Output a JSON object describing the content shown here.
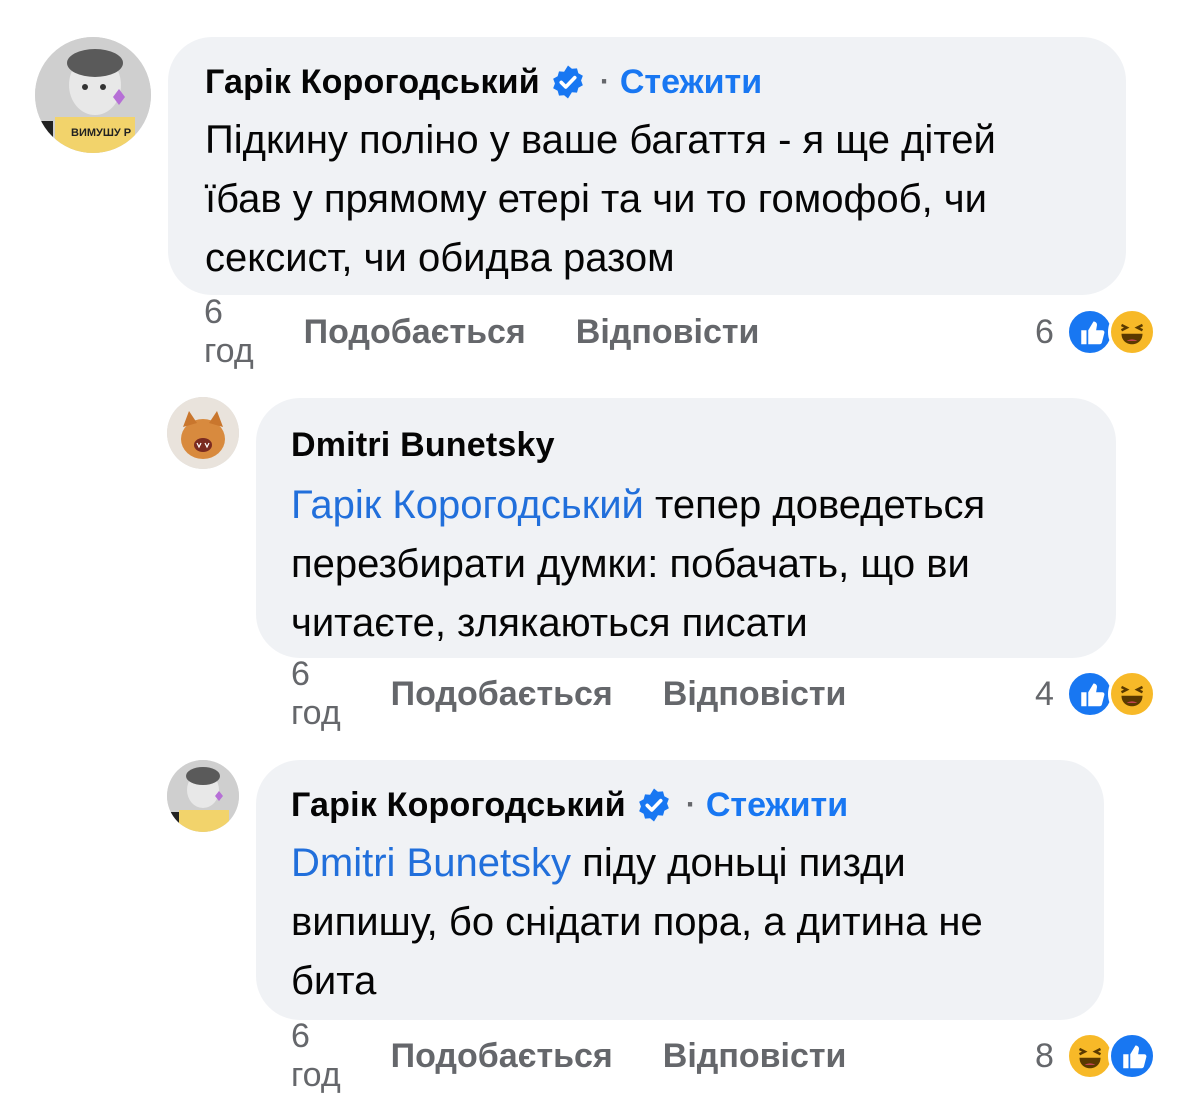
{
  "comments": [
    {
      "author": "Гарік Корогодський",
      "verified": true,
      "follow_label": "Стежити",
      "dot": "·",
      "mention": "",
      "text_lines": [
        "Підкину поліно у ваше багаття - я ще дітей",
        "їбав у прямому етері та чи то гомофоб, чи",
        "сексист, чи обидва разом"
      ],
      "time": "6 год",
      "like_label": "Подобається",
      "reply_label": "Відповісти",
      "reaction_count": "6",
      "reactions": [
        "like-icon",
        "haha-icon"
      ],
      "avatar_text": "ВИМУШУ Р"
    },
    {
      "author": "Dmitri Bunetsky",
      "verified": false,
      "mention": "Гарік Корогодський",
      "text_lines": [
        " тепер доведеться",
        "перезбирати думки: побачать, що ви",
        "читаєте, злякаються писати"
      ],
      "time": "6 год",
      "like_label": "Подобається",
      "reply_label": "Відповісти",
      "reaction_count": "4",
      "reactions": [
        "like-icon",
        "haha-icon"
      ]
    },
    {
      "author": "Гарік Корогодський",
      "verified": true,
      "follow_label": "Стежити",
      "dot": "·",
      "mention": "Dmitri Bunetsky",
      "text_lines": [
        " піду доньці пизди",
        "випишу, бо снідати пора, а дитина не",
        "бита"
      ],
      "time": "6 год",
      "like_label": "Подобається",
      "reply_label": "Відповісти",
      "reaction_count": "8",
      "reactions": [
        "haha-icon",
        "like-icon"
      ]
    }
  ],
  "colors": {
    "bubble": "#f0f2f5",
    "link": "#1877f2",
    "mention": "#216fdb",
    "meta": "#65676b",
    "like": "#1877f2",
    "haha": "#f7b928"
  }
}
